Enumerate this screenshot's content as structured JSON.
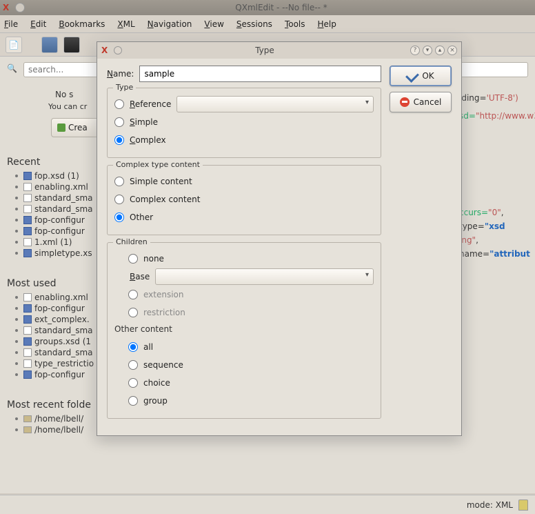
{
  "window": {
    "title": "QXmlEdit - --No file-- *"
  },
  "menu": {
    "file": "File",
    "edit": "Edit",
    "bookmarks": "Bookmarks",
    "xml": "XML",
    "navigation": "Navigation",
    "view": "View",
    "sessions": "Sessions",
    "tools": "Tools",
    "help": "Help"
  },
  "search": {
    "placeholder": "search..."
  },
  "welcome": {
    "line1": "No s",
    "line2": "You can cr",
    "create": "Crea"
  },
  "sections": {
    "recent": "Recent",
    "mostused": "Most used",
    "folders": "Most recent folde"
  },
  "recent": [
    {
      "label": "fop.xsd (1)",
      "blue": true
    },
    {
      "label": "enabling.xml",
      "blue": false
    },
    {
      "label": "standard_sma",
      "blue": false
    },
    {
      "label": "standard_sma",
      "blue": false
    },
    {
      "label": "fop-configur",
      "blue": true
    },
    {
      "label": "fop-configur",
      "blue": true
    },
    {
      "label": "1.xml (1)",
      "blue": false
    },
    {
      "label": "simpletype.xs",
      "blue": true
    }
  ],
  "mostused": [
    {
      "label": "enabling.xml",
      "blue": false
    },
    {
      "label": "fop-configur",
      "blue": true
    },
    {
      "label": "ext_complex.",
      "blue": true
    },
    {
      "label": "standard_sma",
      "blue": false
    },
    {
      "label": "groups.xsd (1",
      "blue": true
    },
    {
      "label": "standard_sma",
      "blue": false
    },
    {
      "label": "type_restrictio",
      "blue": false
    },
    {
      "label": "fop-configur",
      "blue": true
    }
  ],
  "folders": [
    "/home/lbell/",
    "/home/lbell/"
  ],
  "snippet": {
    "l1a": "iding=",
    "l1b": "'UTF-8')",
    "l2a": "sd=",
    "l2b": "\"http://www.w3",
    "l3a": "ccurs=",
    "l3b": "\"0\"",
    "l3c": ", type=",
    "l3d": "\"xsd",
    "l4a": "ing\"",
    "l4b": ", name=",
    "l4c": "\"attribut"
  },
  "status": {
    "mode": "mode: XML"
  },
  "dialog": {
    "title": "Type",
    "name_label": "Name:",
    "name_value": "sample",
    "type_legend": "Type",
    "reference": "Reference",
    "simple": "Simple",
    "complex": "Complex",
    "ctc_legend": "Complex type content",
    "simple_content": "Simple content",
    "complex_content": "Complex content",
    "other": "Other",
    "children_legend": "Children",
    "none": "none",
    "base": "Base",
    "extension": "extension",
    "restriction": "restriction",
    "other_content": "Other content",
    "all": "all",
    "sequence": "sequence",
    "choice": "choice",
    "group": "group",
    "ok": "OK",
    "cancel": "Cancel"
  }
}
